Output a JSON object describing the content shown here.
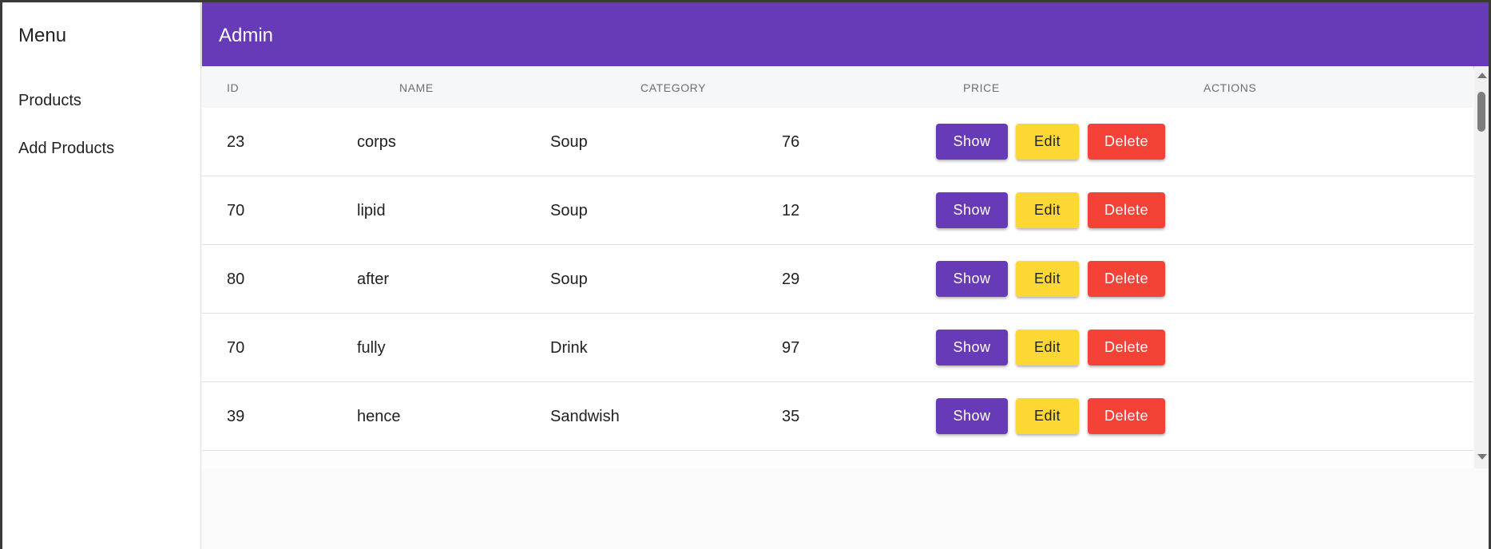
{
  "sidebar": {
    "title": "Menu",
    "items": [
      {
        "label": "Products"
      },
      {
        "label": "Add Products"
      }
    ]
  },
  "appbar": {
    "title": "Admin"
  },
  "table": {
    "columns": [
      "ID",
      "NAME",
      "CATEGORY",
      "PRICE",
      "ACTIONS"
    ],
    "rows": [
      {
        "id": "23",
        "name": "corps",
        "category": "Soup",
        "price": "76"
      },
      {
        "id": "70",
        "name": "lipid",
        "category": "Soup",
        "price": "12"
      },
      {
        "id": "80",
        "name": "after",
        "category": "Soup",
        "price": "29"
      },
      {
        "id": "70",
        "name": "fully",
        "category": "Drink",
        "price": "97"
      },
      {
        "id": "39",
        "name": "hence",
        "category": "Sandwish",
        "price": "35"
      }
    ],
    "actions": {
      "show_label": "Show",
      "edit_label": "Edit",
      "delete_label": "Delete"
    }
  },
  "colors": {
    "primary": "#673ab7",
    "edit": "#fdd835",
    "delete": "#f44336"
  }
}
